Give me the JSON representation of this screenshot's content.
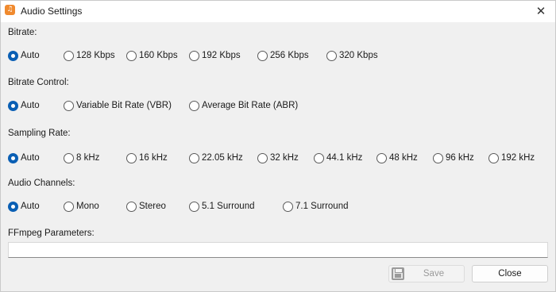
{
  "window": {
    "title": "Audio Settings",
    "close_glyph": "✕",
    "app_icon_glyph": "♫"
  },
  "colors": {
    "accent": "#0a5fb4",
    "app_icon": "#f08a2e"
  },
  "sections": {
    "bitrate": {
      "label": "Bitrate:",
      "options": [
        "Auto",
        "128 Kbps",
        "160 Kbps",
        "192 Kbps",
        "256 Kbps",
        "320 Kbps"
      ],
      "selected": "Auto"
    },
    "bitrate_control": {
      "label": "Bitrate Control:",
      "options": [
        "Auto",
        "Variable Bit Rate (VBR)",
        "Average Bit Rate (ABR)"
      ],
      "selected": "Auto"
    },
    "sampling_rate": {
      "label": "Sampling Rate:",
      "options": [
        "Auto",
        "8 kHz",
        "16 kHz",
        "22.05 kHz",
        "32 kHz",
        "44.1 kHz",
        "48 kHz",
        "96 kHz",
        "192 kHz"
      ],
      "selected": "Auto"
    },
    "audio_channels": {
      "label": "Audio Channels:",
      "options": [
        "Auto",
        "Mono",
        "Stereo",
        "5.1 Surround",
        "7.1 Surround"
      ],
      "selected": "Auto"
    },
    "ffmpeg": {
      "label": "FFmpeg Parameters:",
      "value": ""
    }
  },
  "buttons": {
    "save_label": "Save",
    "close_label": "Close",
    "save_icon": "floppy-disk-icon"
  }
}
